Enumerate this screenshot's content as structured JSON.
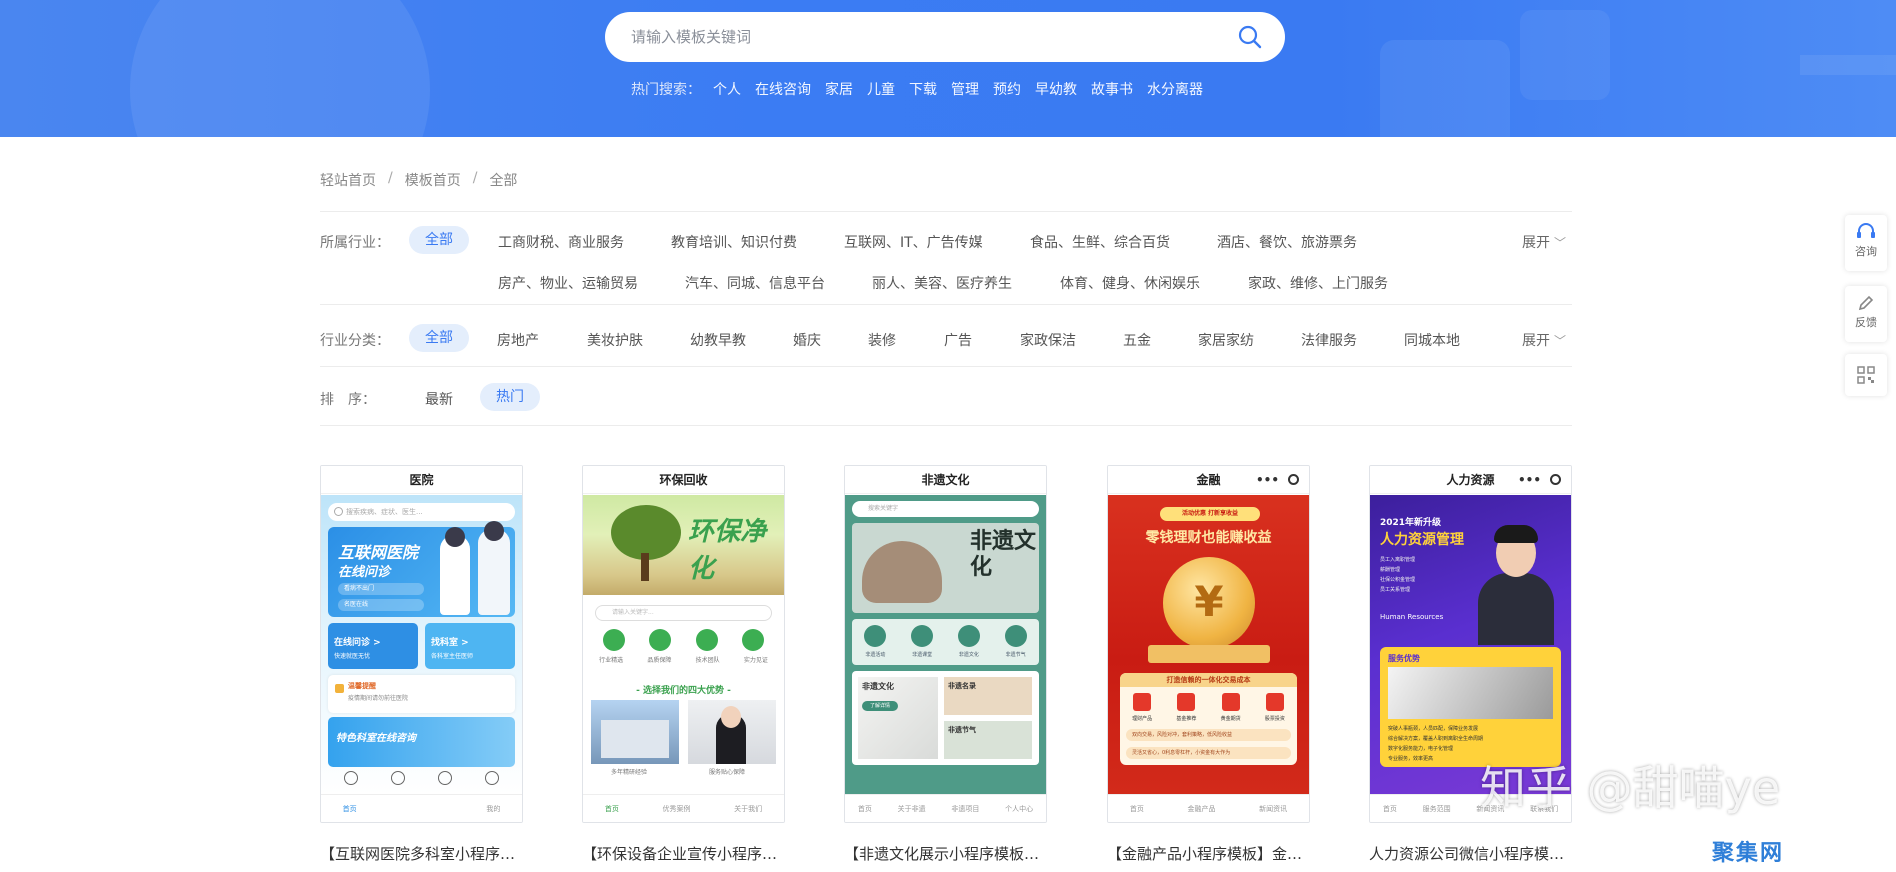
{
  "search": {
    "placeholder": "请输入模板关键词",
    "hot_label": "热门搜索：",
    "hot_terms": [
      "个人",
      "在线咨询",
      "家居",
      "儿童",
      "下载",
      "管理",
      "预约",
      "早幼教",
      "故事书",
      "水分离器"
    ]
  },
  "breadcrumb": [
    "轻站首页",
    "模板首页",
    "全部"
  ],
  "filters": {
    "industry": {
      "label": "所属行业：",
      "selected": "全部",
      "row1": [
        "工商财税、商业服务",
        "教育培训、知识付费",
        "互联网、IT、广告传媒",
        "食品、生鲜、综合百货",
        "酒店、餐饮、旅游票务"
      ],
      "row2": [
        "房产、物业、运输贸易",
        "汽车、同城、信息平台",
        "丽人、美容、医疗养生",
        "体育、健身、休闲娱乐",
        "家政、维修、上门服务"
      ],
      "expand": "展开"
    },
    "category": {
      "label": "行业分类：",
      "selected": "全部",
      "items": [
        "房地产",
        "美妆护肤",
        "幼教早教",
        "婚庆",
        "装修",
        "广告",
        "家政保洁",
        "五金",
        "家居家纺",
        "法律服务",
        "同城本地"
      ],
      "expand": "展开"
    },
    "sort": {
      "label": "排　序：",
      "items": [
        "最新",
        "热门"
      ],
      "selected": "热门"
    }
  },
  "cards": [
    {
      "header": "医院",
      "caption": "【互联网医院多科室小程序…",
      "screen": {
        "search": "搜索疾病、症状、医生...",
        "hero_title": "互联网医院",
        "hero_sub": "在线问诊",
        "hero_b1": "看病不出门",
        "hero_b2": "名医在线",
        "box1_title": "在线问诊 >",
        "box1_sub": "快速就医无忧",
        "box2_title": "找科室 >",
        "box2_sub": "各科室主任医师",
        "notice_title": "温馨提醒",
        "notice_sub": "疫情期间请勿前往医院",
        "dept_title": "特色科室在线咨询",
        "tabs": [
          "首页",
          "",
          "",
          "我的"
        ]
      }
    },
    {
      "header": "环保回收",
      "caption": "【环保设备企业宣传小程序…",
      "screen": {
        "hero_title": "环保净化",
        "search": "请输入关键字...",
        "icons": [
          "行业精选",
          "品质保障",
          "技术团队",
          "实力见证"
        ],
        "subtitle": "- 选择我们的四大优势 -",
        "photo1_caption": "多年精研经验",
        "photo2_caption": "服务贴心保障",
        "tabs": [
          "首页",
          "优秀案例",
          "关于我们"
        ]
      }
    },
    {
      "header": "非遗文化",
      "caption": "【非遗文化展示小程序模板…",
      "screen": {
        "search": "搜索关键字",
        "hero_text": "非遗文化",
        "icons": [
          "非遗活动",
          "非遗课堂",
          "非遗文化",
          "非遗节气"
        ],
        "card1_title": "非遗文化",
        "card1_button": "了解详情",
        "card2_title": "非遗名录",
        "card3_title": "非遗节气",
        "tabs": [
          "首页",
          "关于非遗",
          "非遗项目",
          "个人中心"
        ]
      }
    },
    {
      "header": "金融",
      "caption": "【金融产品小程序模板】金…",
      "screen": {
        "tag": "活动优惠 打新享收益",
        "title": "零钱理财也能赚收益",
        "coin": "¥",
        "panel_title": "打造信赖的一体化交易成本",
        "icons": [
          "理财产品",
          "基金推荐",
          "黄金期货",
          "股票投资"
        ],
        "rows": [
          "双向交易，风险对冲，套利策略，低风险收益",
          "灵活又省心，0利息零杠杆，小资金有大作为"
        ],
        "tabs": [
          "首页",
          "金融产品",
          "新闻资讯"
        ]
      }
    },
    {
      "header": "人力资源",
      "caption": "人力资源公司微信小程序模…",
      "screen": {
        "sub": "2021年新升级",
        "title": "人力资源管理",
        "lines": [
          "员工入离职管理",
          "薪酬管理",
          "社保公积金管理",
          "员工关系管理"
        ],
        "en": "Human Resources",
        "panel_title": "服务优势",
        "points": [
          "突破人事瓶颈，人员匹配，保障业务发展",
          "综合解决方案，覆盖人职到离职全生命周期",
          "数字化服务能力，电子化管理",
          "专业服务，效率更高"
        ],
        "tabs": [
          "首页",
          "服务范围",
          "新闻资讯",
          "联系我们"
        ]
      }
    }
  ],
  "side_tools": {
    "consult": "咨询",
    "feedback": "反馈"
  },
  "watermark": {
    "text": "知乎 @甜喵ye",
    "logo": "聚集网"
  },
  "colors": {
    "banner": "#3a7af2",
    "accent": "#3a7af2",
    "pill_bg": "#e4eefc"
  }
}
